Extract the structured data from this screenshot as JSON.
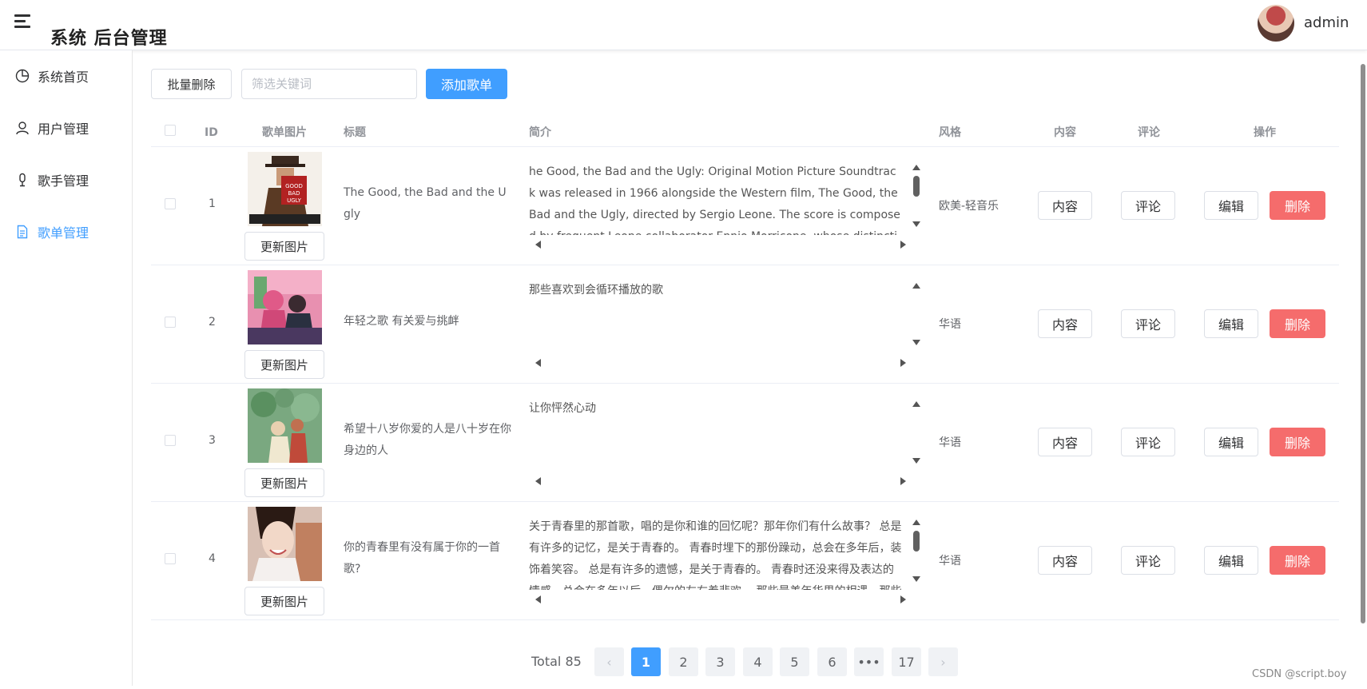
{
  "header": {
    "title": "系统 后台管理",
    "username": "admin"
  },
  "sidebar": {
    "items": [
      {
        "label": "系统首页",
        "icon": "pie-chart-icon",
        "active": false
      },
      {
        "label": "用户管理",
        "icon": "user-icon",
        "active": false
      },
      {
        "label": "歌手管理",
        "icon": "microphone-icon",
        "active": false
      },
      {
        "label": "歌单管理",
        "icon": "document-icon",
        "active": true
      }
    ]
  },
  "toolbar": {
    "batch_delete_label": "批量删除",
    "search_placeholder": "筛选关键词",
    "search_value": "",
    "add_label": "添加歌单"
  },
  "table": {
    "columns": [
      "ID",
      "歌单图片",
      "标题",
      "简介",
      "风格",
      "内容",
      "评论",
      "操作"
    ],
    "update_image_label": "更新图片",
    "content_label": "内容",
    "comment_label": "评论",
    "edit_label": "编辑",
    "delete_label": "删除",
    "rows": [
      {
        "id": "1",
        "title": "The Good, the Bad and the Ugly",
        "intro": "he Good, the Bad and the Ugly: Original Motion Picture Soundtrack was released in 1966 alongside the Western film, The Good, the Bad and the Ugly, directed by Sergio Leone. The score is composed by frequent Leone collaborator Ennio Morricone, whose distinctive original composit",
        "style": "欧美-轻音乐"
      },
      {
        "id": "2",
        "title": "年轻之歌 有关爱与挑衅",
        "intro": "那些喜欢到会循环播放的歌",
        "style": "华语"
      },
      {
        "id": "3",
        "title": "希望十八岁你爱的人是八十岁在你身边的人",
        "intro": "让你怦然心动",
        "style": "华语"
      },
      {
        "id": "4",
        "title": "你的青春里有没有属于你的一首歌?",
        "intro": "关于青春里的那首歌，唱的是你和谁的回忆呢？那年你们有什么故事？ 总是有许多的记忆，是关于青春的。 青春时埋下的那份躁动，总会在多年后，装饰着笑容。 总是有许多的遗憾，是关于青春的。 青春时还没来得及表达的情感，总会在多年以后，偶尔的左右着悲欢。 那些最美年华里的相遇，那些青",
        "style": "华语"
      }
    ]
  },
  "pagination": {
    "total_label": "Total 85",
    "pages": [
      "1",
      "2",
      "3",
      "4",
      "5",
      "6",
      "•••",
      "17"
    ],
    "current": "1",
    "prev": "‹",
    "next": "›"
  },
  "watermark": "CSDN @script.boy",
  "colors": {
    "primary": "#409eff",
    "danger": "#f56c6c",
    "border": "#dcdfe6"
  }
}
